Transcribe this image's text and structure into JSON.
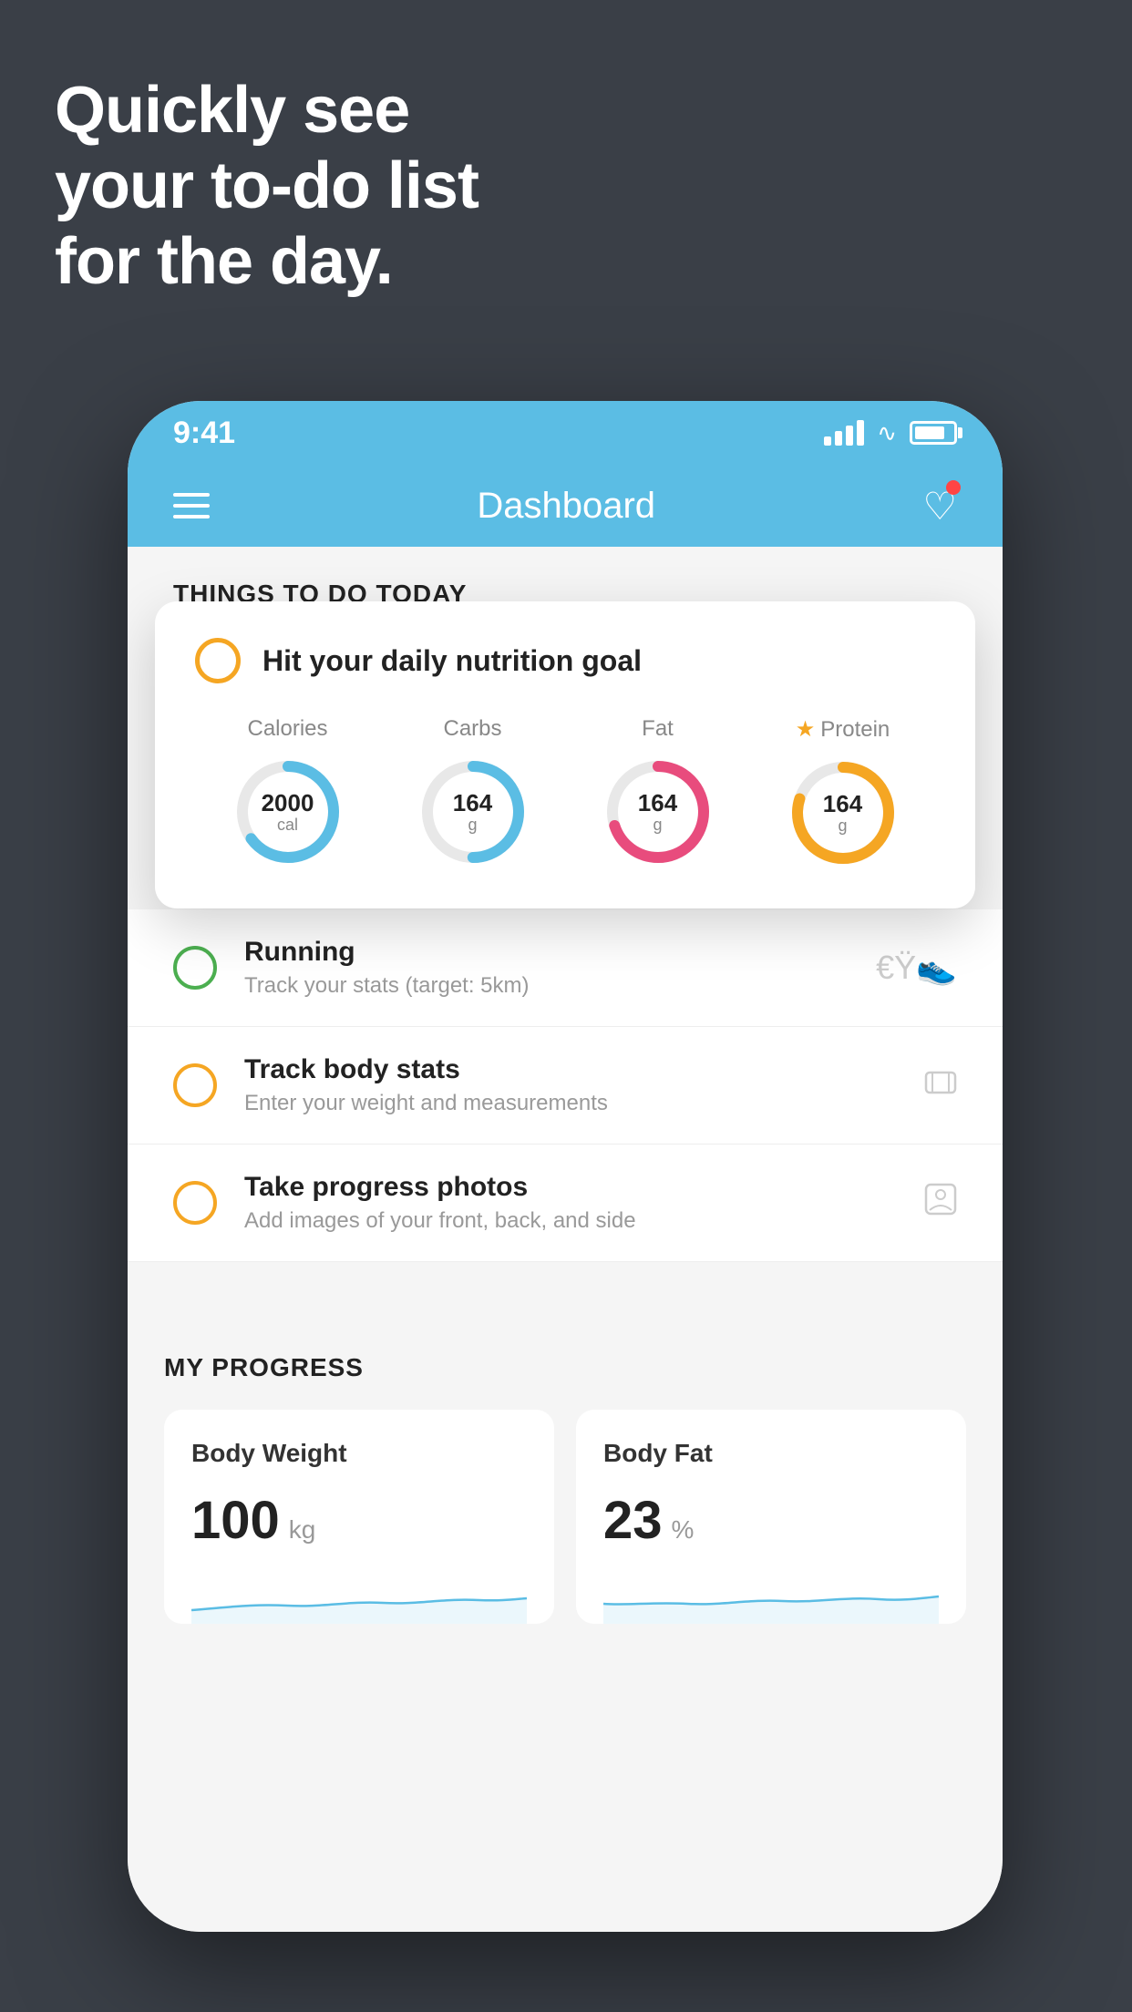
{
  "hero": {
    "line1": "Quickly see",
    "line2": "your to-do list",
    "line3": "for the day."
  },
  "status_bar": {
    "time": "9:41"
  },
  "nav": {
    "title": "Dashboard"
  },
  "things_section": {
    "header": "THINGS TO DO TODAY"
  },
  "nutrition_card": {
    "check_label": "circle-check",
    "title": "Hit your daily nutrition goal",
    "stats": [
      {
        "label": "Calories",
        "value": "2000",
        "unit": "cal",
        "color": "#5bbde4",
        "pct": 65,
        "starred": false
      },
      {
        "label": "Carbs",
        "value": "164",
        "unit": "g",
        "color": "#5bbde4",
        "pct": 50,
        "starred": false
      },
      {
        "label": "Fat",
        "value": "164",
        "unit": "g",
        "color": "#e84c7d",
        "pct": 70,
        "starred": false
      },
      {
        "label": "Protein",
        "value": "164",
        "unit": "g",
        "color": "#f5a623",
        "pct": 80,
        "starred": true
      }
    ]
  },
  "todo_items": [
    {
      "name": "Running",
      "desc": "Track your stats (target: 5km)",
      "circle_color": "green",
      "icon": "shoe"
    },
    {
      "name": "Track body stats",
      "desc": "Enter your weight and measurements",
      "circle_color": "yellow",
      "icon": "scale"
    },
    {
      "name": "Take progress photos",
      "desc": "Add images of your front, back, and side",
      "circle_color": "yellow",
      "icon": "person"
    }
  ],
  "progress_section": {
    "header": "MY PROGRESS",
    "cards": [
      {
        "title": "Body Weight",
        "value": "100",
        "unit": "kg"
      },
      {
        "title": "Body Fat",
        "value": "23",
        "unit": "%"
      }
    ]
  }
}
